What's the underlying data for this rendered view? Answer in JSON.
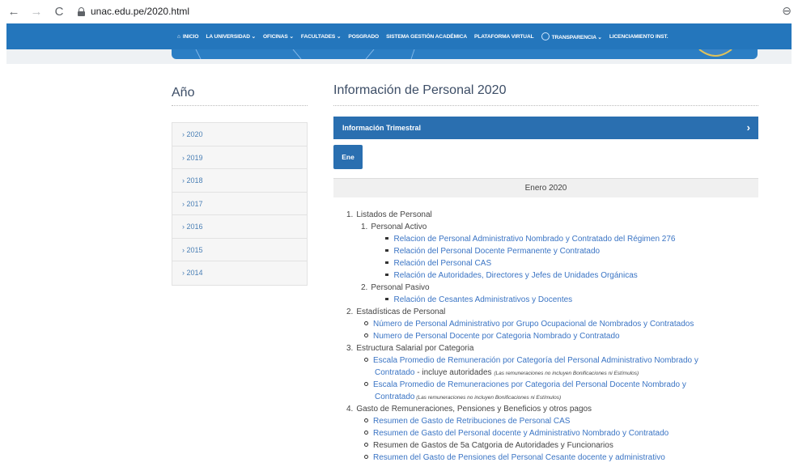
{
  "browser": {
    "url": "unac.edu.pe/2020.html"
  },
  "nav": {
    "items": [
      {
        "label": "INICIO",
        "icon": "home-icon"
      },
      {
        "label": "LA UNIVERSIDAD ⌄"
      },
      {
        "label": "OFICINAS ⌄"
      },
      {
        "label": "FACULTADES ⌄"
      },
      {
        "label": "POSGRADO"
      },
      {
        "label": "SISTEMA GESTIÓN ACADÉMICA"
      },
      {
        "label": "PLATAFORMA VIRTUAL"
      },
      {
        "label": "TRANSPARENCIA ⌄",
        "icon": "transparency-icon"
      },
      {
        "label": "LICENCIAMIENTO INST."
      }
    ]
  },
  "sidebar": {
    "title": "Año",
    "years": [
      "› 2020",
      "› 2019",
      "› 2018",
      "› 2017",
      "› 2016",
      "› 2015",
      "› 2014"
    ]
  },
  "main": {
    "title": "Información de Personal 2020",
    "accordion_label": "Información Trimestral",
    "month_button": "Ene",
    "month_heading": "Enero 2020",
    "sections": {
      "s1": "Listados de Personal",
      "s1_1": "Personal Activo",
      "s1_1_a": "Relacion de Personal Administrativo Nombrado y Contratado del Régimen 276",
      "s1_1_b": "Relación del Personal Docente Permanente y Contratado",
      "s1_1_c": "Relación del Personal CAS",
      "s1_1_d": "Relación de Autoridades, Directores y Jefes de Unidades Orgánicas",
      "s1_2": "Personal Pasivo",
      "s1_2_a": "Relación de Cesantes Administrativos y Docentes",
      "s2": "Estadísticas de Personal",
      "s2_a": "Número de Personal Administrativo por Grupo Ocupacional de Nombrados y Contratados",
      "s2_b": "Numero de Personal Docente por Categoria Nombrado y Contratado",
      "s3": "Estructura Salarial por Categoria",
      "s3_a1": "Escala Promedio de Remuneración por Categoría del Personal Administrativo Nombrado y",
      "s3_a2": "Contratado",
      "s3_a_text": " - incluye autoridades ",
      "s3_a_note": "(Las remuneraciones no incluyen Bonificaciones ni Estímulos)",
      "s3_b1": "Escala Promedio de Remuneraciones por Categoria del Personal Docente Nombrado y",
      "s3_b2": "Contratado",
      "s3_b_note": " (Las remuneraciones no incluyen Bonificaciones ni Estímulos)",
      "s4": "Gasto de Remuneraciones, Pensiones y Beneficios y otros pagos",
      "s4_a": "Resumen de Gasto de Retribuciones de Personal CAS",
      "s4_b": "Resumen de Gasto del Personal docente y Administrativo Nombrado y Contratado",
      "s4_c": "Resumen de Gastos de 5a Catgoria de Autoridades y Funcionarios",
      "s4_d": "Resumen del Gasto de Pensiones del Personal Cesante docente y administrativo"
    },
    "numbers": {
      "n1": "1.",
      "n1_1": "1.",
      "n1_2": "2.",
      "n2": "2.",
      "n3": "3.",
      "n4": "4."
    }
  },
  "colors": {
    "nav_bg": "#2476bc",
    "accordion_bg": "#2a6fb0",
    "link": "#3a74c4"
  }
}
